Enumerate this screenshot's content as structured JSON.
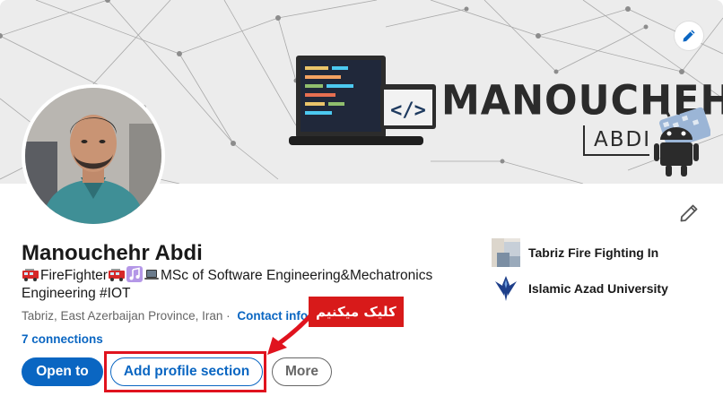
{
  "banner": {
    "title": "MANOUCHEHR",
    "subtitle": "ABDI",
    "code_symbol": "</>"
  },
  "profile": {
    "name": "Manouchehr Abdi",
    "headline_text": "FireFighter",
    "headline_rest": "MSc of Software Engineering&Mechatronics Engineering #IOT",
    "location": "Tabriz, East Azerbaijan Province, Iran",
    "location_separator": "·",
    "contact_link": "Contact info",
    "connections": "7 connections"
  },
  "actions": {
    "open_to": "Open to",
    "add_section": "Add profile section",
    "more": "More"
  },
  "annotation": {
    "label": "کلیک میکنیم",
    "color": "#d81a1a"
  },
  "organizations": [
    {
      "name": "Tabriz Fire Fighting In",
      "logo": "building-placeholder-icon"
    },
    {
      "name": "Islamic Azad University",
      "logo": "university-logo-icon"
    }
  ],
  "colors": {
    "primary": "#0a66c2",
    "text": "#191919",
    "muted": "#666666",
    "annotation": "#e0131e"
  }
}
